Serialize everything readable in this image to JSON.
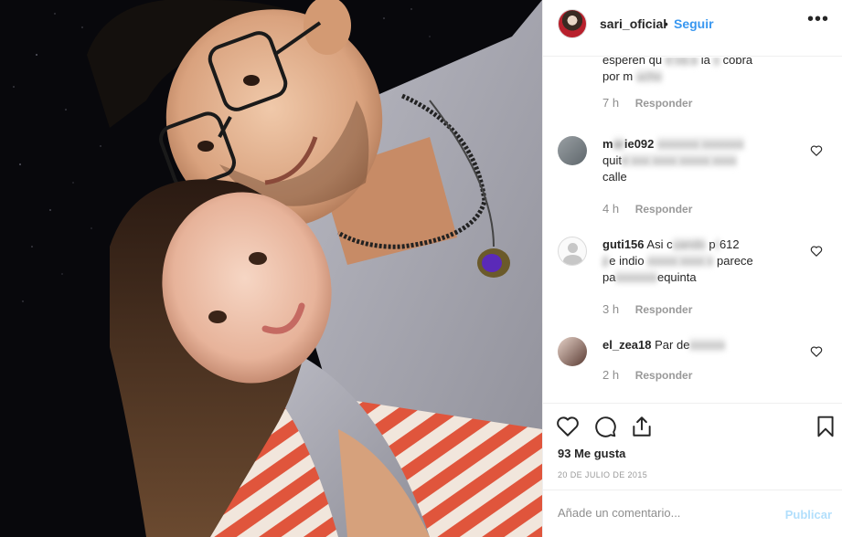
{
  "header": {
    "username": "sari_oficial",
    "separator": "•",
    "follow_label": "Seguir",
    "more_icon": "more-horizontal-icon",
    "more_glyph": "•••"
  },
  "comments": [
    {
      "username": "",
      "text_start": "esperen qu",
      "text_blur1": "e va a",
      "text_mid": "la",
      "text_blur2": "s",
      "text_end": "cobra",
      "text_line2_start": "por m",
      "text_line2_blur": "ucho",
      "time": "7 h",
      "reply_label": "Responder"
    },
    {
      "username": "m",
      "username_blur": "ar",
      "username_end": "ie092",
      "text_blur_tail": "xxxxxxx xxxxxxx",
      "text_line2_start": "quit",
      "text_line2_blur": "e xxx xxxx xxxxx xxxx",
      "text_line3": "calle",
      "time": "4 h",
      "reply_label": "Responder",
      "heart_icon": "heart-outline-icon"
    },
    {
      "username": "guti156",
      "text_start": "Asi c",
      "text_blur1": "uando",
      "text_mid": "",
      "text_end": "p",
      "text_blur2": "r",
      "text_tail": "612",
      "text_line2_blur1": "p",
      "text_line2_mid": "e indio",
      "text_line2_blur2": "xxxxx xxxx x",
      "text_line2_end": "parece",
      "text_line3_start": "pa",
      "text_line3_blur": "xxxxxxx",
      "text_line3_end": "equinta",
      "time": "3 h",
      "reply_label": "Responder",
      "heart_icon": "heart-outline-icon"
    },
    {
      "username": "el_zea18",
      "text_start": "Par de",
      "text_blur1": "xxxxxx",
      "time": "2 h",
      "reply_label": "Responder",
      "heart_icon": "heart-outline-icon"
    }
  ],
  "actions": {
    "like_icon": "heart-outline-icon",
    "comment_icon": "comment-bubble-icon",
    "share_icon": "share-upload-icon",
    "save_icon": "bookmark-icon"
  },
  "likes_text": "93 Me gusta",
  "date_text": "20 DE JULIO DE 2015",
  "add_comment": {
    "placeholder": "Añade un comentario...",
    "post_label": "Publicar"
  },
  "colors": {
    "link": "#3897f0",
    "muted": "#8e8e8e",
    "post_disabled": "#b2dffc",
    "border": "#efefef"
  }
}
